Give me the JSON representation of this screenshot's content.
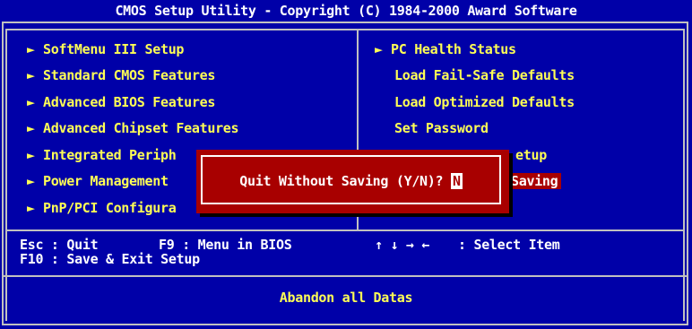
{
  "title": "CMOS Setup Utility - Copyright (C) 1984-2000 Award Software",
  "left_menu": [
    {
      "label": "SoftMenu III Setup",
      "arrow": "►"
    },
    {
      "label": "Standard CMOS Features",
      "arrow": "►"
    },
    {
      "label": "Advanced BIOS Features",
      "arrow": "►"
    },
    {
      "label": "Advanced Chipset Features",
      "arrow": "►"
    },
    {
      "label": "Integrated Periph",
      "arrow": "►"
    },
    {
      "label": "Power Management",
      "arrow": "►"
    },
    {
      "label": "PnP/PCI Configura",
      "arrow": "►"
    }
  ],
  "right_menu": [
    {
      "label": "PC Health Status",
      "arrow": "►"
    },
    {
      "label": "Load Fail-Safe Defaults"
    },
    {
      "label": "Load Optimized Defaults"
    },
    {
      "label": "Set Password"
    },
    {
      "label": "etup"
    },
    {
      "label": "Saving"
    }
  ],
  "help": {
    "esc": "Esc : Quit",
    "f9": "F9 : Menu in BIOS",
    "arrows": "↑ ↓ → ←",
    "select": ": Select Item",
    "f10": "F10 : Save & Exit Setup"
  },
  "status": "Abandon all Datas",
  "dialog": {
    "prompt": "Quit Without Saving (Y/N)?",
    "value": "N"
  },
  "colors": {
    "background": "#0000a8",
    "text": "#ffff55",
    "highlight": "#a80000",
    "dialog": "#a80000"
  }
}
